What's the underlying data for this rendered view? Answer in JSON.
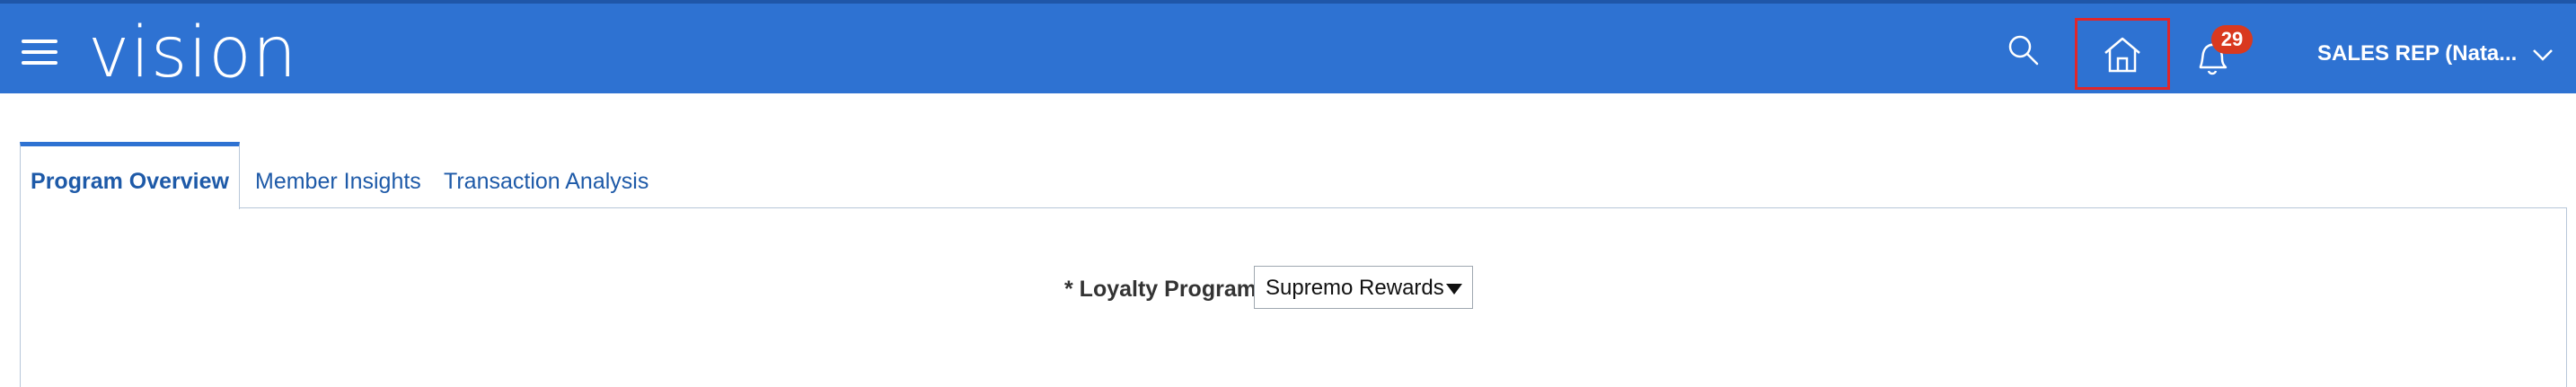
{
  "header": {
    "logo": "vision",
    "notification_count": "29",
    "user_label": "SALES REP (Nata...",
    "background_color": "#2e72d2",
    "badge_color": "#d9391f",
    "highlight_color": "#e0262a",
    "icons": [
      "hamburger-menu-icon",
      "search-icon",
      "home-icon",
      "bell-icon",
      "chevron-down-icon"
    ]
  },
  "tabs": [
    {
      "label": "Program Overview",
      "active": true
    },
    {
      "label": "Member Insights",
      "active": false
    },
    {
      "label": "Transaction Analysis",
      "active": false
    }
  ],
  "form": {
    "loyalty_program_label": "* Loyalty Program",
    "loyalty_program_value": "Supremo Rewards"
  }
}
